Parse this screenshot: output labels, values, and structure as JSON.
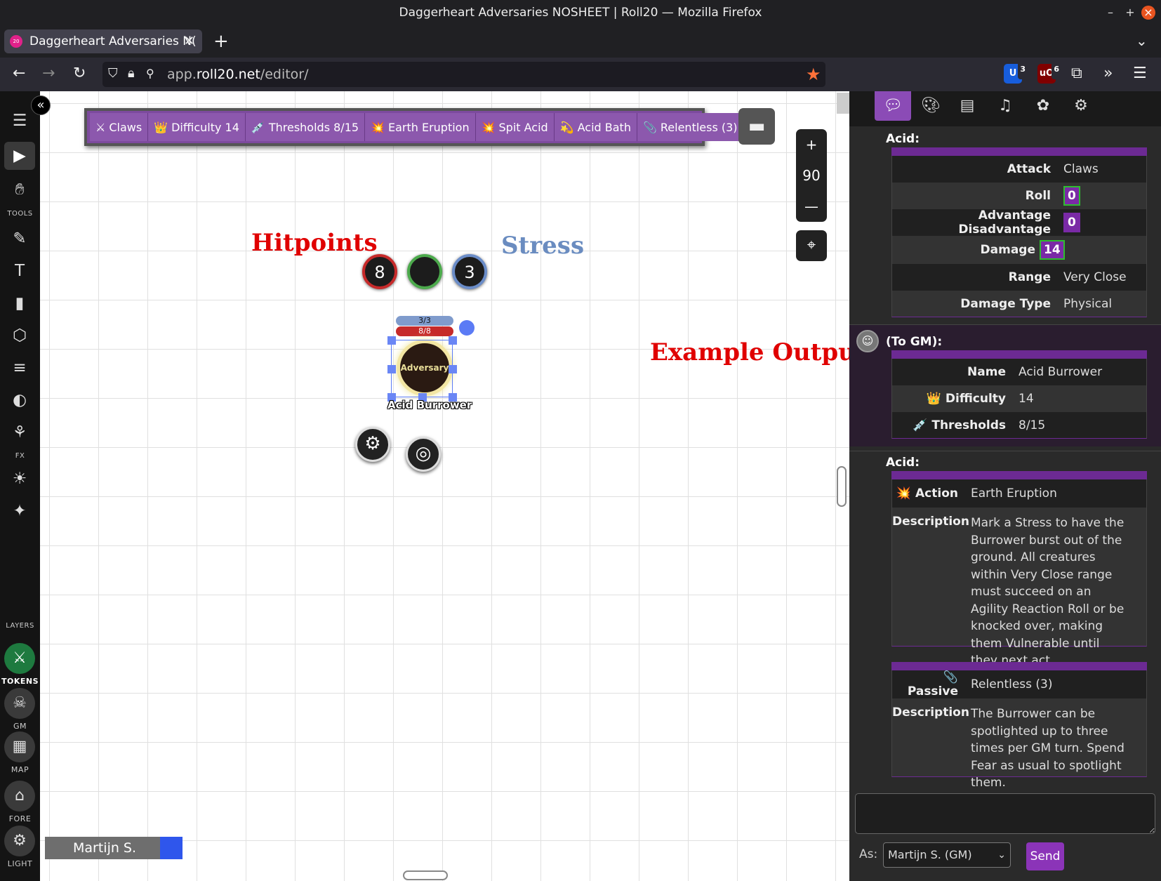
{
  "browser": {
    "window_title": "Daggerheart Adversaries NOSHEET | Roll20 — Mozilla Firefox",
    "tab_title": "Daggerheart Adversaries N(",
    "tab_icon_text": "20",
    "url_prefix": "app.",
    "url_host": "roll20.net",
    "url_path": "/editor/",
    "ext_badges": {
      "bitwarden": "3",
      "ublock": "6"
    }
  },
  "tools": {
    "tools_label": "TOOLS",
    "fx_label": "FX",
    "layers_label": "LAYERS",
    "tokens": "TOKENS",
    "gm": "GM",
    "map": "MAP",
    "fore": "FORE",
    "light": "LIGHT"
  },
  "macros": [
    {
      "icon": "crossed-swords-icon",
      "glyph": "⚔",
      "label": "Claws"
    },
    {
      "icon": "crown-icon",
      "glyph": "👑",
      "label": "Difficulty 14"
    },
    {
      "icon": "syringe-icon",
      "glyph": "💉",
      "label": "Thresholds 8/15"
    },
    {
      "icon": "explosion-icon",
      "glyph": "💥",
      "label": "Earth Eruption"
    },
    {
      "icon": "explosion-icon",
      "glyph": "💥",
      "label": "Spit Acid"
    },
    {
      "icon": "dizzy-star-icon",
      "glyph": "💫",
      "label": "Acid Bath"
    },
    {
      "icon": "paperclip-icon",
      "glyph": "📎",
      "label": "Relentless (3)"
    }
  ],
  "zoom": {
    "value": "90"
  },
  "annotations": {
    "hitpoints": "Hitpoints",
    "stress": "Stress",
    "example_output": "Example Output"
  },
  "token": {
    "hp_circle": "8",
    "mid_circle": "",
    "stress_circle": "3",
    "stress_bar": "3/3",
    "hp_bar": "8/8",
    "label": "Adversary",
    "name": "Acid Burrower"
  },
  "player": {
    "name": "Martijn S.",
    "color": "#2f56ec"
  },
  "chat": {
    "m1": {
      "header": "Acid:",
      "rows": [
        {
          "k": "Attack",
          "v": "Claws"
        },
        {
          "k": "Roll",
          "v": "0"
        },
        {
          "k": "Advantage Disadvantage",
          "v": "0"
        },
        {
          "k": "Damage",
          "v": "14"
        },
        {
          "k": "Range",
          "v": "Very Close"
        },
        {
          "k": "Damage Type",
          "v": "Physical"
        }
      ]
    },
    "m2": {
      "header": "(To GM):",
      "rows": [
        {
          "k": "Name",
          "v": "Acid Burrower"
        },
        {
          "k": "Difficulty",
          "v": "14",
          "icon": "👑"
        },
        {
          "k": "Thresholds",
          "v": "8/15",
          "icon": "💉"
        }
      ]
    },
    "m3": {
      "header": "Acid:",
      "action_k": "Action",
      "action_v": "Earth Eruption",
      "desc_k": "Description",
      "desc_v": "Mark a Stress to have the Burrower burst out of the ground. All creatures within Very Close range must succeed on an Agility Reaction Roll or be knocked over, making them Vulnerable until they next act.",
      "passive_k": "Passive",
      "passive_v": "Relentless (3)",
      "desc2_k": "Description",
      "desc2_v": "The Burrower can be spotlighted up to three times per GM turn. Spend Fear as usual to spotlight them."
    },
    "as_label": "As:",
    "as_value": "Martijn S. (GM)",
    "send": "Send"
  },
  "colors": {
    "accent_purple": "#8b4bb6",
    "hp_red": "#c62a2a",
    "stress_blue": "#7f9bcc",
    "annotation_red": "#e00000",
    "annotation_blue": "#6a8cc0"
  }
}
